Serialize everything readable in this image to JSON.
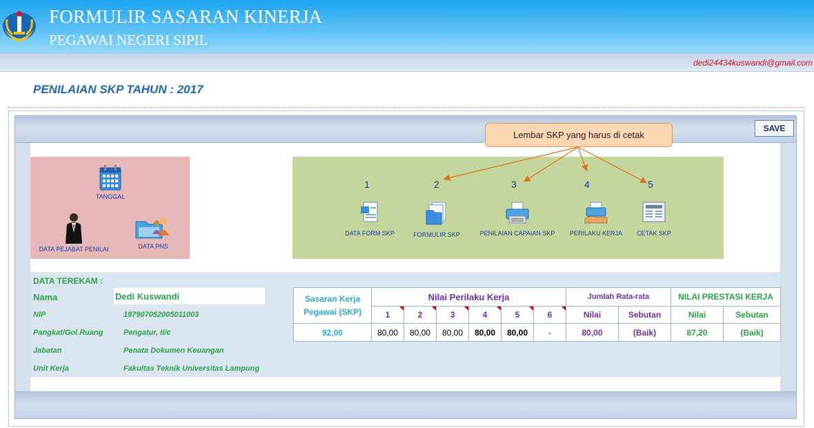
{
  "header": {
    "title": "FORMULIR SASARAN KINERJA",
    "subtitle": "PEGAWAI NEGERI SIPIL",
    "email": "dedi24434kuswandi@gmail.com"
  },
  "page_title": "PENILAIAN SKP TAHUN : 2017",
  "save_label": "SAVE",
  "callout": "Lembar SKP yang harus di cetak",
  "left_menu": {
    "tanggal": "TANGGAL",
    "pejabat": "DATA PEJABAT PENILAI",
    "pns": "DATA PNS"
  },
  "print_menu": {
    "numbers": [
      "1",
      "2",
      "3",
      "4",
      "5"
    ],
    "labels": [
      "DATA FORM SKP",
      "FORMULIR SKP",
      "PENILAIAN CAPAIAN SKP",
      "PERILAKU KERJA",
      "CETAK SKP"
    ]
  },
  "data_terekam": {
    "title": "DATA TEREKAM :",
    "labels": {
      "nama": "Nama",
      "nip": "NIP",
      "pangkat": "Pangkat/Gol.Ruang",
      "jabatan": "Jabatan",
      "unit": "Unit Kerja"
    },
    "values": {
      "nama": "Dedi Kuswandi",
      "nip": "197907052005011003",
      "pangkat": "Pengatur, II/c",
      "jabatan": "Penata Dokumen Keuangan",
      "unit": "Fakultas Teknik Universitas Lampung"
    }
  },
  "score_table": {
    "headers": {
      "skp": "Sasaran Kerja Pegawai (SKP)",
      "perilaku": "Nilai Perilaku Kerja",
      "rata": "Jumlah Rata-rata",
      "prestasi": "NILAI PRESTASI KERJA",
      "nilai": "Nilai",
      "sebutan": "Sebutan",
      "nilai2": "Nilai",
      "sebutan2": "Sebutan",
      "cols": [
        "1",
        "2",
        "3",
        "4",
        "5",
        "6"
      ]
    },
    "values": {
      "skp": "92,00",
      "perilaku": [
        "80,00",
        "80,00",
        "80,00",
        "80,00",
        "80,00",
        "-"
      ],
      "rata_nilai": "80,00",
      "rata_sebutan": "(Baik)",
      "prestasi_nilai": "87,20",
      "prestasi_sebutan": "(Baik)"
    }
  }
}
